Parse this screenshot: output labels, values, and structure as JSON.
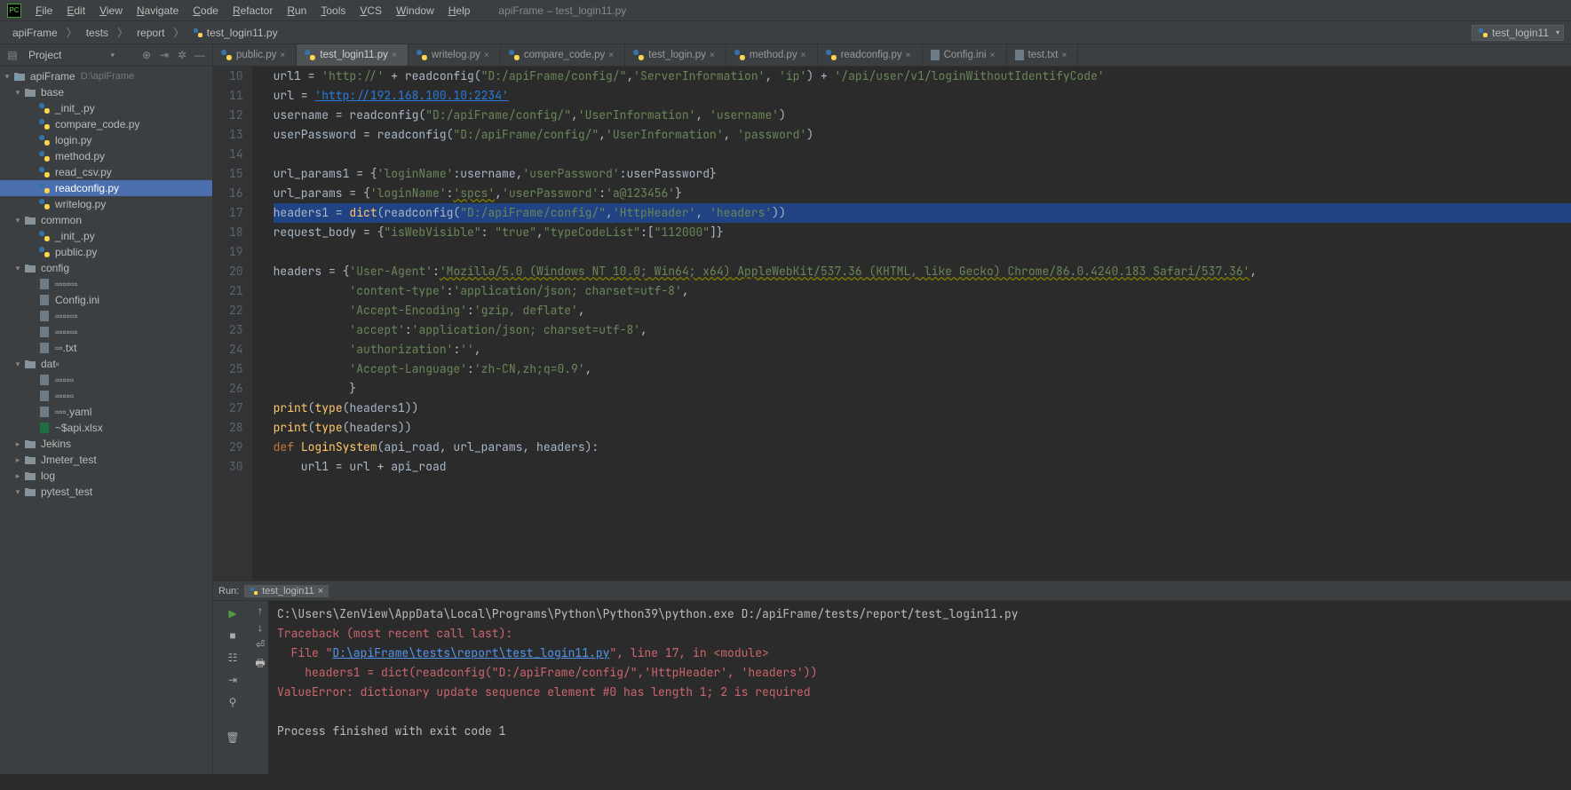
{
  "menubar": {
    "items": [
      "File",
      "Edit",
      "View",
      "Navigate",
      "Code",
      "Refactor",
      "Run",
      "Tools",
      "VCS",
      "Window",
      "Help"
    ],
    "title": "apiFrame – test_login11.py"
  },
  "breadcrumb": {
    "items": [
      "apiFrame",
      "tests",
      "report",
      "test_login11.py"
    ]
  },
  "run_selector": "test_login11",
  "sidebar": {
    "title": "Project",
    "nodes": [
      {
        "indent": 0,
        "expander": "▾",
        "type": "module",
        "label": "apiFrame",
        "meta": "D:\\apiFrame"
      },
      {
        "indent": 1,
        "expander": "▾",
        "type": "folder",
        "label": "base"
      },
      {
        "indent": 2,
        "expander": "",
        "type": "py",
        "label": "_init_.py"
      },
      {
        "indent": 2,
        "expander": "",
        "type": "py",
        "label": "compare_code.py"
      },
      {
        "indent": 2,
        "expander": "",
        "type": "py",
        "label": "login.py"
      },
      {
        "indent": 2,
        "expander": "",
        "type": "py",
        "label": "method.py"
      },
      {
        "indent": 2,
        "expander": "",
        "type": "py",
        "label": "read_csv.py"
      },
      {
        "indent": 2,
        "expander": "",
        "type": "py",
        "label": "readconfig.py",
        "selected": true
      },
      {
        "indent": 2,
        "expander": "",
        "type": "py",
        "label": "writelog.py"
      },
      {
        "indent": 1,
        "expander": "▾",
        "type": "folder",
        "label": "common"
      },
      {
        "indent": 2,
        "expander": "",
        "type": "py",
        "label": "_init_.py"
      },
      {
        "indent": 2,
        "expander": "",
        "type": "py",
        "label": "public.py"
      },
      {
        "indent": 1,
        "expander": "▾",
        "type": "folder",
        "label": "config"
      },
      {
        "indent": 2,
        "expander": "",
        "type": "txt",
        "label": "▫▫▫▫▫▫"
      },
      {
        "indent": 2,
        "expander": "",
        "type": "ini",
        "label": "Config.ini"
      },
      {
        "indent": 2,
        "expander": "",
        "type": "txt",
        "label": "▫▫▫▫▫▫"
      },
      {
        "indent": 2,
        "expander": "",
        "type": "txt",
        "label": "▫▫▫▫▫▫"
      },
      {
        "indent": 2,
        "expander": "",
        "type": "txt",
        "label": "▫▫.txt"
      },
      {
        "indent": 1,
        "expander": "▾",
        "type": "folder",
        "label": "dat▫"
      },
      {
        "indent": 2,
        "expander": "",
        "type": "txt",
        "label": "▫▫▫▫▫"
      },
      {
        "indent": 2,
        "expander": "",
        "type": "txt",
        "label": "▫▫▫▫▫"
      },
      {
        "indent": 2,
        "expander": "",
        "type": "txt",
        "label": "▫▫▫.yaml"
      },
      {
        "indent": 2,
        "expander": "",
        "type": "xls",
        "label": "~$api.xlsx"
      },
      {
        "indent": 1,
        "expander": "▸",
        "type": "folder",
        "label": "Jekins"
      },
      {
        "indent": 1,
        "expander": "▸",
        "type": "folder",
        "label": "Jmeter_test"
      },
      {
        "indent": 1,
        "expander": "▸",
        "type": "folder",
        "label": "log"
      },
      {
        "indent": 1,
        "expander": "▾",
        "type": "folder",
        "label": "pytest_test"
      }
    ]
  },
  "tabs": [
    {
      "label": "public.py",
      "type": "py"
    },
    {
      "label": "test_login11.py",
      "type": "py",
      "active": true
    },
    {
      "label": "writelog.py",
      "type": "py"
    },
    {
      "label": "compare_code.py",
      "type": "py"
    },
    {
      "label": "test_login.py",
      "type": "py"
    },
    {
      "label": "method.py",
      "type": "py"
    },
    {
      "label": "readconfig.py",
      "type": "py"
    },
    {
      "label": "Config.ini",
      "type": "ini"
    },
    {
      "label": "test.txt",
      "type": "txt"
    }
  ],
  "editor": {
    "first_line": 10,
    "highlighted_line": 17,
    "lines": [
      [
        {
          "t": "var",
          "v": "url1 = "
        },
        {
          "t": "str",
          "v": "'http://'"
        },
        {
          "t": "var",
          "v": " + readconfig("
        },
        {
          "t": "str",
          "v": "\"D:/apiFrame/config/\""
        },
        {
          "t": "var",
          "v": ","
        },
        {
          "t": "str",
          "v": "'ServerInformation'"
        },
        {
          "t": "var",
          "v": ", "
        },
        {
          "t": "str",
          "v": "'ip'"
        },
        {
          "t": "var",
          "v": ") + "
        },
        {
          "t": "str",
          "v": "'/api/user/v1/loginWithoutIdentifyCode'"
        }
      ],
      [
        {
          "t": "var",
          "v": "url = "
        },
        {
          "t": "link",
          "v": "'http://192.168.100.10:2234'"
        }
      ],
      [
        {
          "t": "var",
          "v": "username = readconfig("
        },
        {
          "t": "str",
          "v": "\"D:/apiFrame/config/\""
        },
        {
          "t": "var",
          "v": ","
        },
        {
          "t": "str",
          "v": "'UserInformation'"
        },
        {
          "t": "var",
          "v": ", "
        },
        {
          "t": "str",
          "v": "'username'"
        },
        {
          "t": "var",
          "v": ")"
        }
      ],
      [
        {
          "t": "var",
          "v": "userPassword = readconfig("
        },
        {
          "t": "str",
          "v": "\"D:/apiFrame/config/\""
        },
        {
          "t": "var",
          "v": ","
        },
        {
          "t": "str",
          "v": "'UserInformation'"
        },
        {
          "t": "var",
          "v": ", "
        },
        {
          "t": "str",
          "v": "'password'"
        },
        {
          "t": "var",
          "v": ")"
        }
      ],
      [],
      [
        {
          "t": "var",
          "v": "url_params1 = {"
        },
        {
          "t": "str",
          "v": "'loginName'"
        },
        {
          "t": "var",
          "v": ":username,"
        },
        {
          "t": "str",
          "v": "'userPassword'"
        },
        {
          "t": "var",
          "v": ":userPassword}"
        }
      ],
      [
        {
          "t": "var",
          "v": "url_params = {"
        },
        {
          "t": "str",
          "v": "'loginName'"
        },
        {
          "t": "var",
          "v": ":"
        },
        {
          "t": "warn",
          "v": "'spcs'"
        },
        {
          "t": "var",
          "v": ","
        },
        {
          "t": "str",
          "v": "'userPassword'"
        },
        {
          "t": "var",
          "v": ":"
        },
        {
          "t": "str",
          "v": "'a@123456'"
        },
        {
          "t": "var",
          "v": "}"
        }
      ],
      [
        {
          "t": "var",
          "v": "headers1 = "
        },
        {
          "t": "fn",
          "v": "dict"
        },
        {
          "t": "var",
          "v": "(readconfig("
        },
        {
          "t": "str",
          "v": "\"D:/apiFrame/config/\""
        },
        {
          "t": "var",
          "v": ","
        },
        {
          "t": "str",
          "v": "'HttpHeader'"
        },
        {
          "t": "var",
          "v": ", "
        },
        {
          "t": "str",
          "v": "'headers'"
        },
        {
          "t": "var",
          "v": "))"
        }
      ],
      [
        {
          "t": "var",
          "v": "request_body = {"
        },
        {
          "t": "str",
          "v": "\"isWebVisible\""
        },
        {
          "t": "var",
          "v": ": "
        },
        {
          "t": "str",
          "v": "\"true\""
        },
        {
          "t": "var",
          "v": ","
        },
        {
          "t": "str",
          "v": "\"typeCodeList\""
        },
        {
          "t": "var",
          "v": ":["
        },
        {
          "t": "str",
          "v": "\"112000\""
        },
        {
          "t": "var",
          "v": "]}"
        }
      ],
      [],
      [
        {
          "t": "var",
          "v": "headers = {"
        },
        {
          "t": "str",
          "v": "'User-Agent'"
        },
        {
          "t": "var",
          "v": ":"
        },
        {
          "t": "warn",
          "v": "'Mozilla/5.0 (Windows NT 10.0; Win64; x64) AppleWebKit/537.36 (KHTML, like Gecko) Chrome/86.0.4240.183 Safari/537.36'"
        },
        {
          "t": "var",
          "v": ","
        }
      ],
      [
        {
          "t": "var",
          "v": "           "
        },
        {
          "t": "str",
          "v": "'content-type'"
        },
        {
          "t": "var",
          "v": ":"
        },
        {
          "t": "str",
          "v": "'application/json; charset=utf-8'"
        },
        {
          "t": "var",
          "v": ","
        }
      ],
      [
        {
          "t": "var",
          "v": "           "
        },
        {
          "t": "str",
          "v": "'Accept-Encoding'"
        },
        {
          "t": "var",
          "v": ":"
        },
        {
          "t": "str",
          "v": "'gzip, deflate'"
        },
        {
          "t": "var",
          "v": ","
        }
      ],
      [
        {
          "t": "var",
          "v": "           "
        },
        {
          "t": "str",
          "v": "'accept'"
        },
        {
          "t": "var",
          "v": ":"
        },
        {
          "t": "str",
          "v": "'application/json; charset=utf-8'"
        },
        {
          "t": "var",
          "v": ","
        }
      ],
      [
        {
          "t": "var",
          "v": "           "
        },
        {
          "t": "str",
          "v": "'authorization'"
        },
        {
          "t": "var",
          "v": ":"
        },
        {
          "t": "str",
          "v": "''"
        },
        {
          "t": "var",
          "v": ","
        }
      ],
      [
        {
          "t": "var",
          "v": "           "
        },
        {
          "t": "str",
          "v": "'Accept-Language'"
        },
        {
          "t": "var",
          "v": ":"
        },
        {
          "t": "str",
          "v": "'zh-CN,zh;q=0.9'"
        },
        {
          "t": "var",
          "v": ","
        }
      ],
      [
        {
          "t": "var",
          "v": "           }"
        }
      ],
      [
        {
          "t": "fn",
          "v": "print"
        },
        {
          "t": "var",
          "v": "("
        },
        {
          "t": "fn",
          "v": "type"
        },
        {
          "t": "var",
          "v": "(headers1))"
        }
      ],
      [
        {
          "t": "fn",
          "v": "print"
        },
        {
          "t": "var",
          "v": "("
        },
        {
          "t": "fn",
          "v": "type"
        },
        {
          "t": "var",
          "v": "(headers))"
        }
      ],
      [
        {
          "t": "kw",
          "v": "def "
        },
        {
          "t": "fn",
          "v": "LoginSystem"
        },
        {
          "t": "var",
          "v": "(api_road, url_params, headers):"
        }
      ],
      [
        {
          "t": "var",
          "v": "    url1 = url + api_road"
        }
      ]
    ]
  },
  "run": {
    "label": "Run:",
    "tab": "test_login11",
    "output": [
      {
        "cls": "",
        "text": "C:\\Users\\ZenView\\AppData\\Local\\Programs\\Python\\Python39\\python.exe D:/apiFrame/tests/report/test_login11.py"
      },
      {
        "cls": "err",
        "text": "Traceback (most recent call last):"
      },
      {
        "cls": "err",
        "text": "  File \"",
        "link": "D:\\apiFrame\\tests\\report\\test_login11.py",
        "text2": "\", line 17, in <module>"
      },
      {
        "cls": "err",
        "text": "    headers1 = dict(readconfig(\"D:/apiFrame/config/\",'HttpHeader', 'headers'))"
      },
      {
        "cls": "err",
        "text": "ValueError: dictionary update sequence element #0 has length 1; 2 is required"
      },
      {
        "cls": "",
        "text": ""
      },
      {
        "cls": "",
        "text": "Process finished with exit code 1"
      }
    ]
  }
}
